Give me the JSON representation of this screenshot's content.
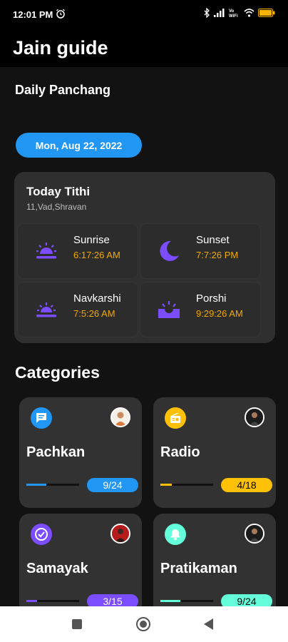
{
  "status": {
    "time": "12:01 PM",
    "icons": [
      "alarm-icon",
      "bluetooth-icon",
      "signal-icon",
      "volte-icon",
      "wifi-icon",
      "battery-icon"
    ]
  },
  "app": {
    "title": "Jain guide"
  },
  "panchang": {
    "section_title": "Daily Panchang",
    "date": "Mon, Aug 22, 2022",
    "card_title": "Today Tithi",
    "tithi": "11,Vad,Shravan",
    "times": [
      {
        "label": "Sunrise",
        "value": "6:17:26 AM",
        "icon": "sunrise-icon"
      },
      {
        "label": "Sunset",
        "value": "7:7:26 PM",
        "icon": "moon-icon"
      },
      {
        "label": "Navkarshi",
        "value": "7:5:26 AM",
        "icon": "sunrise-icon"
      },
      {
        "label": "Porshi",
        "value": "9:29:26 AM",
        "icon": "sun-rays-icon"
      }
    ]
  },
  "categories": {
    "title": "Categories",
    "items": [
      {
        "name": "Pachkan",
        "progress": "9/24",
        "color": "#2196f3",
        "icon": "message-icon",
        "fraction": 0.375
      },
      {
        "name": "Radio",
        "progress": "4/18",
        "color": "#ffc107",
        "icon": "radio-icon",
        "fraction": 0.222
      },
      {
        "name": "Samayak",
        "progress": "3/15",
        "color": "#7c4dff",
        "icon": "check-circle-icon",
        "fraction": 0.2
      },
      {
        "name": "Pratikaman",
        "progress": "9/24",
        "color": "#64ffda",
        "icon": "bell-icon",
        "fraction": 0.375
      }
    ]
  },
  "nav": {
    "icons": [
      "recents-icon",
      "home-icon",
      "back-icon"
    ]
  }
}
